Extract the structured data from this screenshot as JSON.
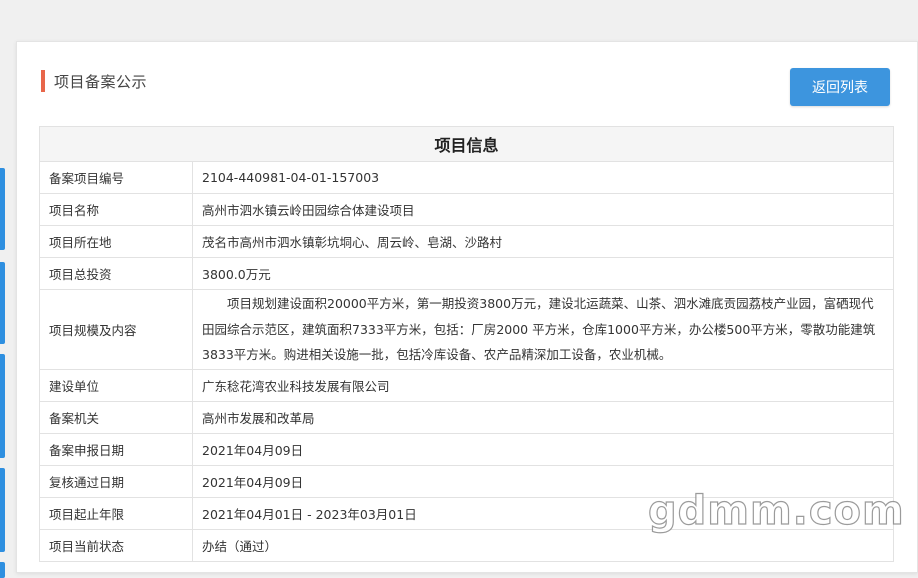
{
  "page": {
    "title": "项目备案公示",
    "back_button_label": "返回列表",
    "table_heading": "项目信息",
    "watermark": "gdmm.com"
  },
  "rows": [
    {
      "label": "备案项目编号",
      "value": "2104-440981-04-01-157003"
    },
    {
      "label": "项目名称",
      "value": "高州市泗水镇云岭田园综合体建设项目"
    },
    {
      "label": "项目所在地",
      "value": "茂名市高州市泗水镇彰坑垌心、周云岭、皂湖、沙路村"
    },
    {
      "label": "项目总投资",
      "value": "3800.0万元"
    },
    {
      "label": "项目规模及内容",
      "value": "项目规划建设面积20000平方米，第一期投资3800万元，建设北运蔬菜、山茶、泗水滩底贡园荔枝产业园，富硒现代田园综合示范区，建筑面积7333平方米，包括：厂房2000 平方米，仓库1000平方米，办公楼500平方米，零散功能建筑3833平方米。购进相关设施一批，包括冷库设备、农产品精深加工设备，农业机械。"
    },
    {
      "label": "建设单位",
      "value": "广东稔花湾农业科技发展有限公司"
    },
    {
      "label": "备案机关",
      "value": "高州市发展和改革局"
    },
    {
      "label": "备案申报日期",
      "value": "2021年04月09日"
    },
    {
      "label": "复核通过日期",
      "value": "2021年04月09日"
    },
    {
      "label": "项目起止年限",
      "value": "2021年04月01日 - 2023年03月01日"
    },
    {
      "label": "项目当前状态",
      "value": "办结（通过）"
    }
  ],
  "colors": {
    "accent_bar": "#e8664a",
    "button": "#3d95de",
    "side_tab": "#2e8fe0"
  }
}
